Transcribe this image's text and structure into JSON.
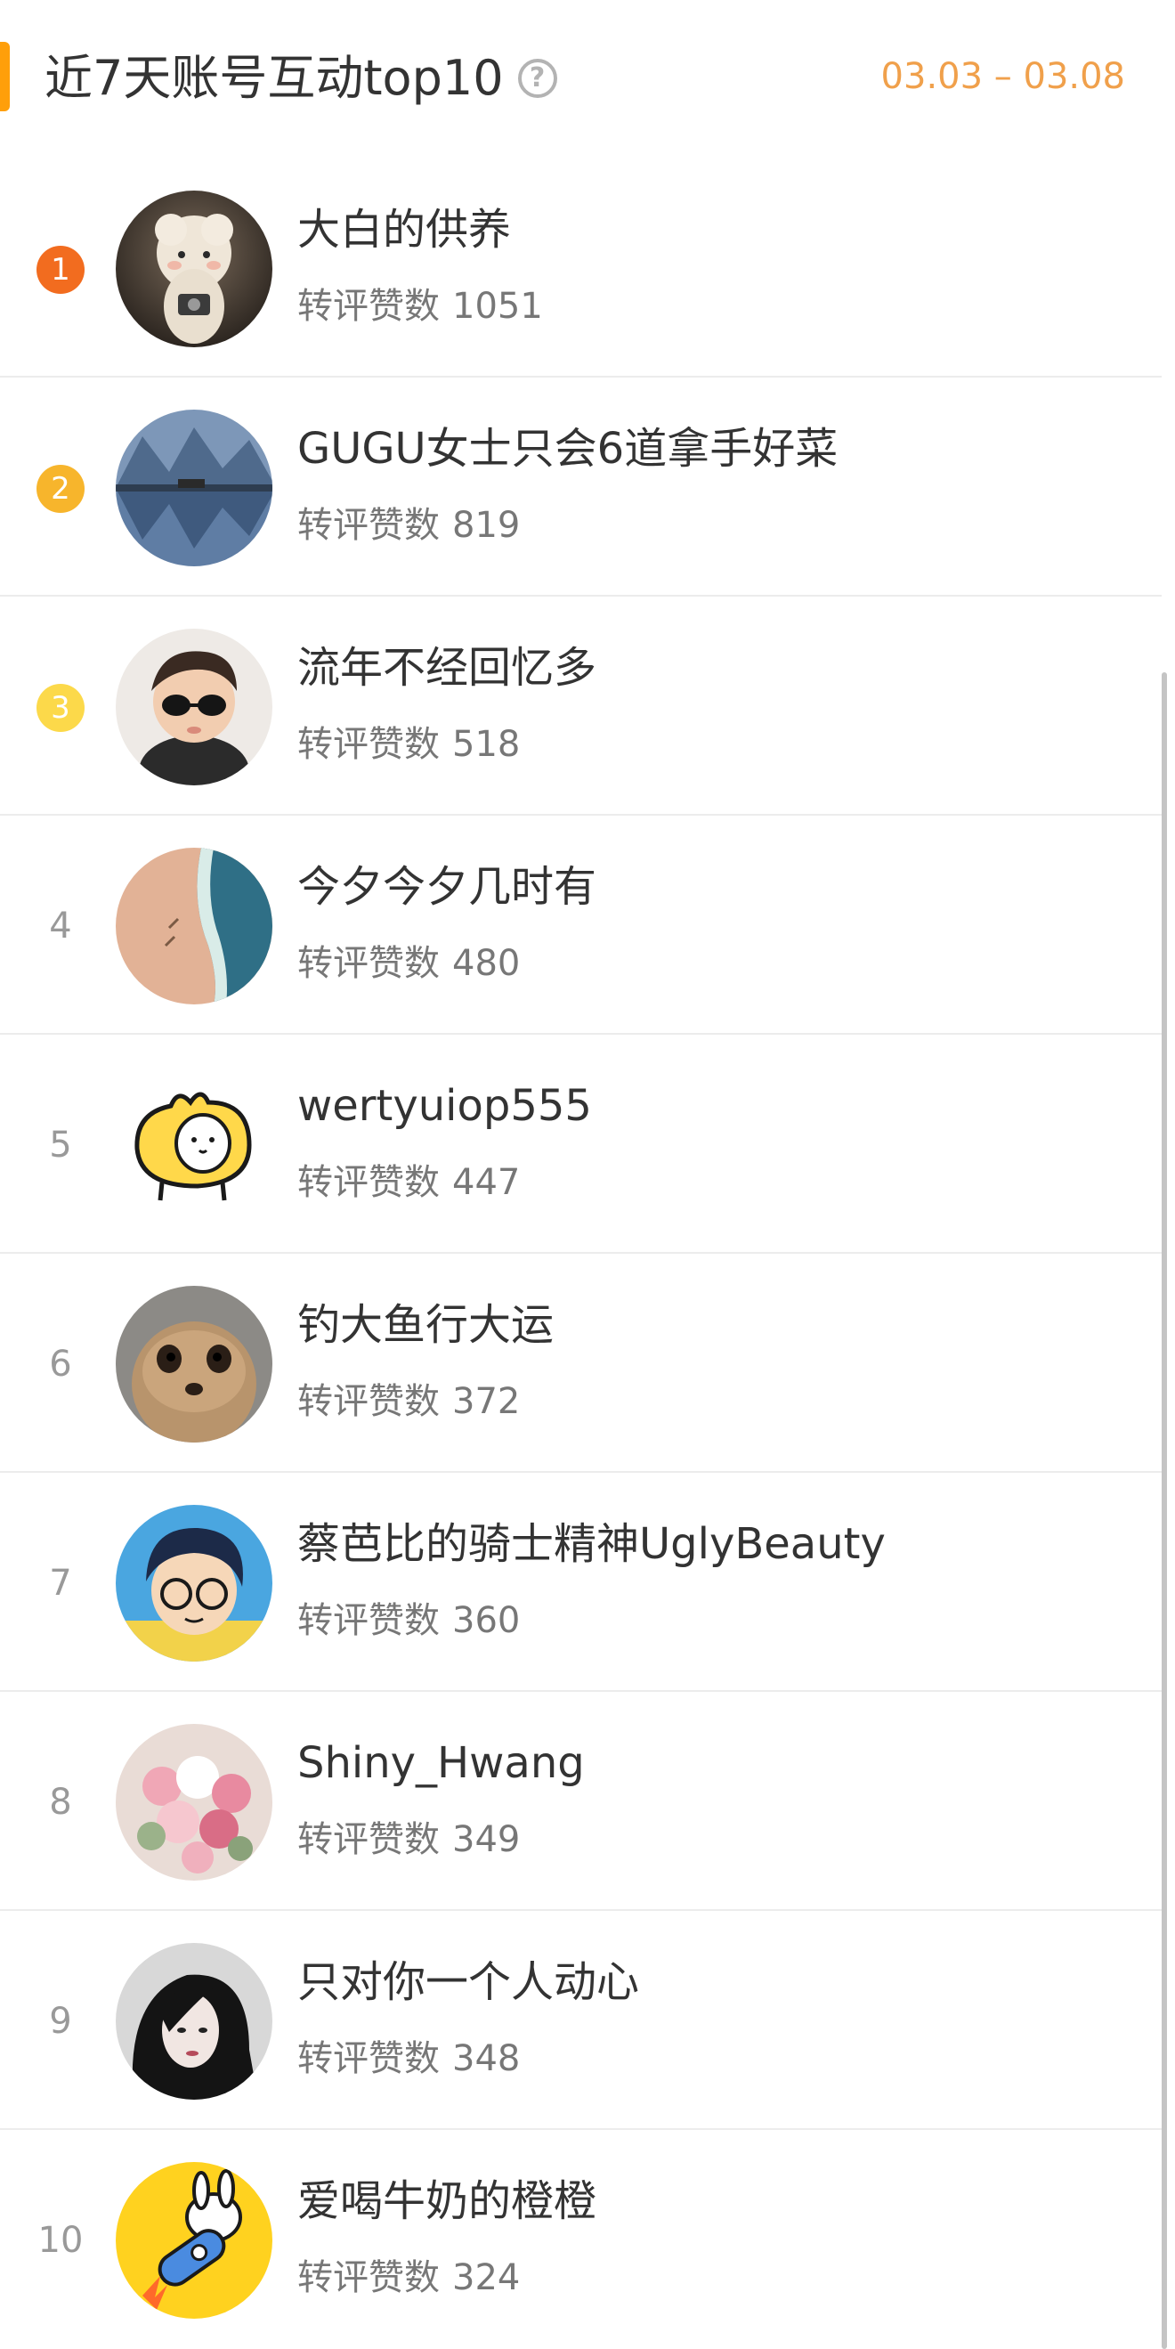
{
  "header": {
    "title": "近7天账号互动top10",
    "help_icon": "help-circle-icon",
    "date_range": "03.03 – 03.08",
    "accent_color": "#ff9f0a",
    "date_color": "#f0a04b"
  },
  "metric_label": "转评赞数",
  "rank_badge_colors": [
    "#f26c1f",
    "#f7b52c",
    "#fcd94a"
  ],
  "entries": [
    {
      "rank": "1",
      "name": "大白的供养",
      "count": "1051",
      "avatar": "fluffy-white-plush-toy-avatar"
    },
    {
      "rank": "2",
      "name": "GUGU女士只会6道拿手好菜",
      "count": "819",
      "avatar": "mountain-lake-reflection-avatar"
    },
    {
      "rank": "3",
      "name": "流年不经回忆多",
      "count": "518",
      "avatar": "boy-with-sunglasses-avatar"
    },
    {
      "rank": "4",
      "name": "今夕今夕几时有",
      "count": "480",
      "avatar": "beach-waves-aerial-avatar"
    },
    {
      "rank": "5",
      "name": "wertyuiop555",
      "count": "447",
      "avatar": "yellow-bunny-cartoon-avatar"
    },
    {
      "rank": "6",
      "name": "钓大鱼行大运",
      "count": "372",
      "avatar": "meerkat-avatar"
    },
    {
      "rank": "7",
      "name": "蔡芭比的骑士精神UglyBeauty",
      "count": "360",
      "avatar": "cartoon-boy-with-glasses-avatar"
    },
    {
      "rank": "8",
      "name": "Shiny_Hwang",
      "count": "349",
      "avatar": "pink-flower-bouquet-avatar"
    },
    {
      "rank": "9",
      "name": "只对你一个人动心",
      "count": "348",
      "avatar": "dark-hair-woman-avatar"
    },
    {
      "rank": "10",
      "name": "爱喝牛奶的橙橙",
      "count": "324",
      "avatar": "rabbit-on-rocket-avatar"
    }
  ]
}
